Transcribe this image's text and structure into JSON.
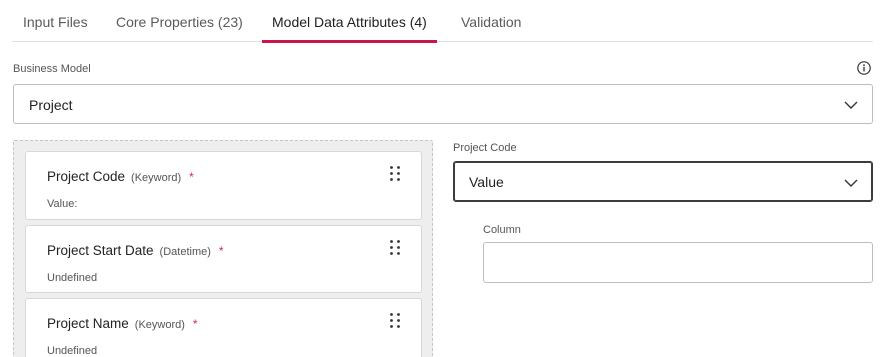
{
  "tabs": [
    {
      "label": "Input Files"
    },
    {
      "label": "Core Properties (23)"
    },
    {
      "label": "Model Data Attributes (4)",
      "active": true
    },
    {
      "label": "Validation"
    }
  ],
  "business_model": {
    "label": "Business Model",
    "value": "Project"
  },
  "attributes": [
    {
      "name": "Project Code",
      "type": "(Keyword)",
      "required": "*",
      "value": "Value:"
    },
    {
      "name": "Project Start Date",
      "type": "(Datetime)",
      "required": "*",
      "value": "Undefined"
    },
    {
      "name": "Project Name",
      "type": "(Keyword)",
      "required": "*",
      "value": "Undefined"
    }
  ],
  "detail": {
    "label": "Project Code",
    "select_value": "Value",
    "column_label": "Column",
    "column_value": ""
  },
  "colors": {
    "accent": "#c8184a",
    "required": "#d0284e"
  },
  "icons": {
    "info": "info-icon",
    "chevron": "chevron-down-icon",
    "drag": "drag-handle-icon"
  }
}
